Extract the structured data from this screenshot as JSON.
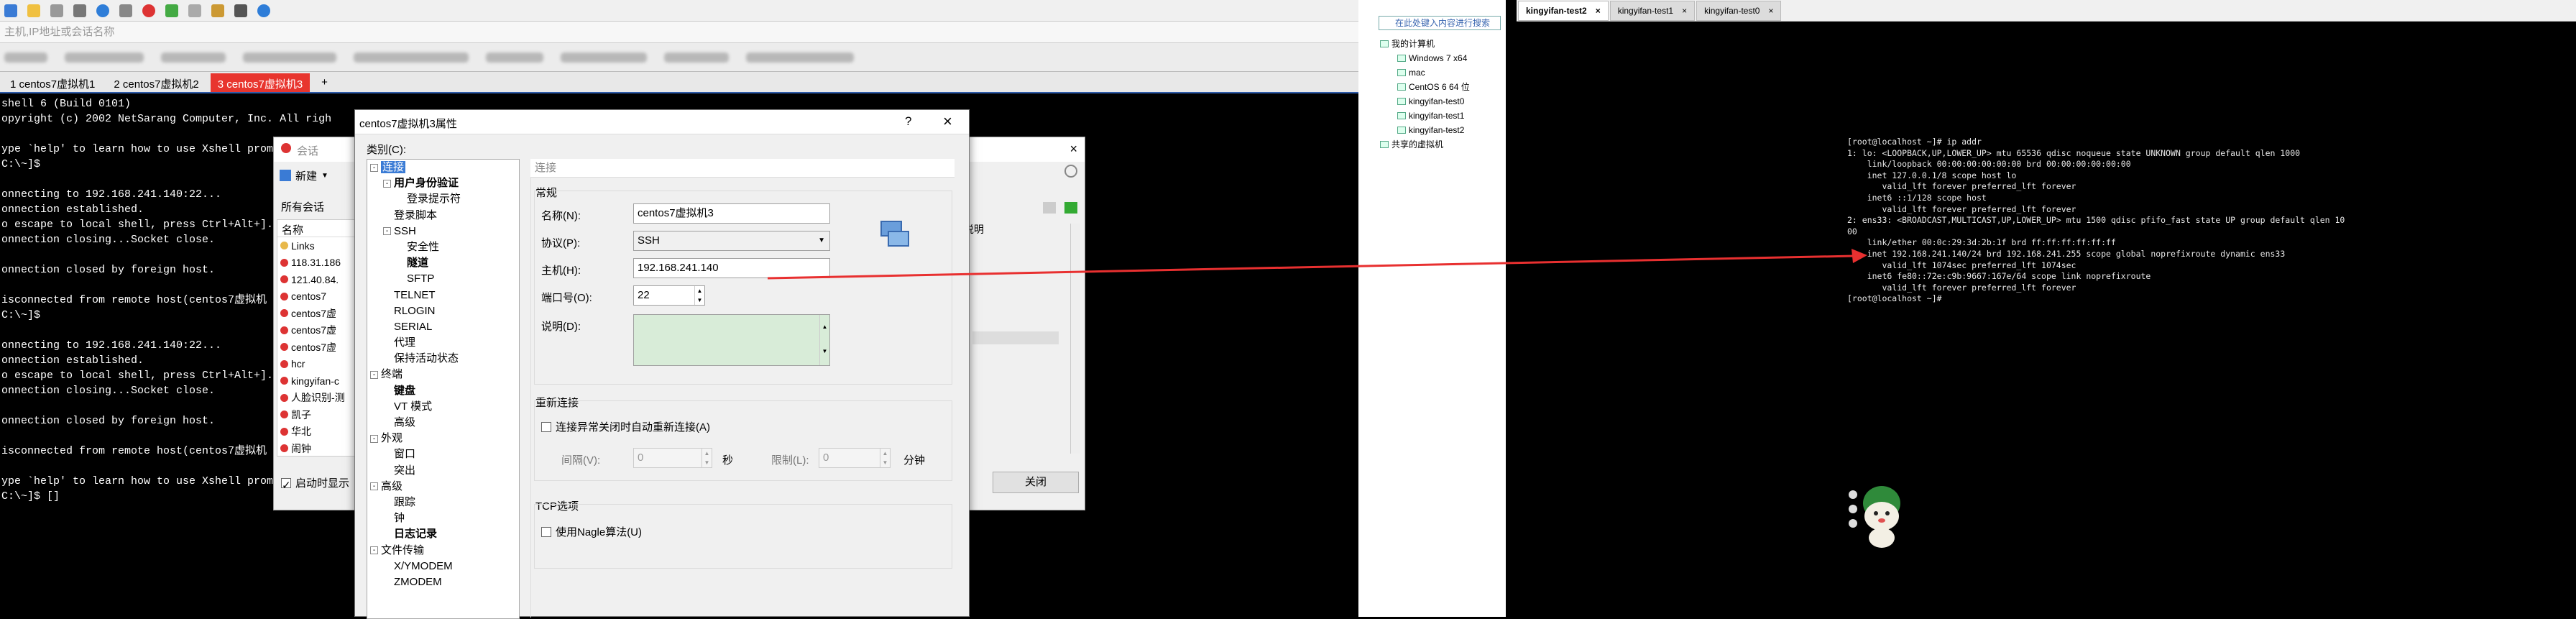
{
  "xshell": {
    "address_placeholder": "主机,IP地址或会话名称",
    "tabs": [
      {
        "label": "1 centos7虚拟机1"
      },
      {
        "label": "2 centos7虚拟机2"
      },
      {
        "label": "3 centos7虚拟机3"
      },
      {
        "label": "+"
      }
    ],
    "terminal_lines": [
      "shell 6 (Build 0101)",
      "opyright (c) 2002 NetSarang Computer, Inc. All righ",
      "",
      "ype `help' to learn how to use Xshell prom",
      "C:\\~]$",
      "",
      "onnecting to 192.168.241.140:22...",
      "onnection established.",
      "o escape to local shell, press Ctrl+Alt+].",
      "onnection closing...Socket close.",
      "",
      "onnection closed by foreign host.",
      "",
      "isconnected from remote host(centos7虚拟机",
      "C:\\~]$",
      "",
      "onnecting to 192.168.241.140:22...",
      "onnection established.",
      "o escape to local shell, press Ctrl+Alt+].",
      "onnection closing...Socket close.",
      "",
      "onnection closed by foreign host.",
      "",
      "isconnected from remote host(centos7虚拟机",
      "",
      "ype `help' to learn how to use Xshell prom",
      "C:\\~]$ []"
    ]
  },
  "session_dialog": {
    "title": "会话",
    "new_label": "新建",
    "all_sessions": "所有会话",
    "column_name": "名称",
    "column_desc": "说明",
    "items": [
      "Links",
      "118.31.186",
      "121.40.84.",
      "centos7",
      "centos7虚",
      "centos7虚",
      "centos7虚",
      "hcr",
      "kingyifan-c",
      "人脸识别-测",
      "凯子",
      "华北",
      "闹钟"
    ],
    "startup_checkbox": "启动时显示",
    "close_label": "关闭"
  },
  "properties_dialog": {
    "title": "centos7虚拟机3属性",
    "help": "?",
    "close": "×",
    "category_label": "类别(C):",
    "tree": [
      {
        "label": "连接",
        "level": 0,
        "box": "-",
        "selected": true
      },
      {
        "label": "用户身份验证",
        "level": 1,
        "box": "-",
        "bold": true
      },
      {
        "label": "登录提示符",
        "level": 2
      },
      {
        "label": "登录脚本",
        "level": 1
      },
      {
        "label": "SSH",
        "level": 1,
        "box": "-"
      },
      {
        "label": "安全性",
        "level": 2
      },
      {
        "label": "隧道",
        "level": 2,
        "bold": true
      },
      {
        "label": "SFTP",
        "level": 2
      },
      {
        "label": "TELNET",
        "level": 1
      },
      {
        "label": "RLOGIN",
        "level": 1
      },
      {
        "label": "SERIAL",
        "level": 1
      },
      {
        "label": "代理",
        "level": 1
      },
      {
        "label": "保持活动状态",
        "level": 1
      },
      {
        "label": "终端",
        "level": 0,
        "box": "-"
      },
      {
        "label": "键盘",
        "level": 1,
        "bold": true
      },
      {
        "label": "VT 模式",
        "level": 1
      },
      {
        "label": "高级",
        "level": 1
      },
      {
        "label": "外观",
        "level": 0,
        "box": "-"
      },
      {
        "label": "窗口",
        "level": 1
      },
      {
        "label": "突出",
        "level": 1
      },
      {
        "label": "高级",
        "level": 0,
        "box": "-"
      },
      {
        "label": "跟踪",
        "level": 1
      },
      {
        "label": "钟",
        "level": 1
      },
      {
        "label": "日志记录",
        "level": 1,
        "bold": true
      },
      {
        "label": "文件传输",
        "level": 0,
        "box": "-"
      },
      {
        "label": "X/YMODEM",
        "level": 1
      },
      {
        "label": "ZMODEM",
        "level": 1
      }
    ],
    "section_header": "连接",
    "general_label": "常规",
    "name_label": "名称(N):",
    "name_value": "centos7虚拟机3",
    "protocol_label": "协议(P):",
    "protocol_value": "SSH",
    "host_label": "主机(H):",
    "host_value": "192.168.241.140",
    "port_label": "端口号(O):",
    "port_value": "22",
    "desc_label": "说明(D):",
    "reconnect_label": "重新连接",
    "reconnect_checkbox": "连接异常关闭时自动重新连接(A)",
    "interval_label": "间隔(V):",
    "interval_value": "0",
    "interval_unit": "秒",
    "limit_label": "限制(L):",
    "limit_value": "0",
    "limit_unit": "分钟",
    "tcp_label": "TCP选项",
    "nagle_checkbox": "使用Nagle算法(U)"
  },
  "vmware": {
    "search_placeholder": "在此处键入内容进行搜索",
    "library": [
      {
        "label": "我的计算机",
        "level": 0
      },
      {
        "label": "Windows 7 x64",
        "level": 1
      },
      {
        "label": "mac",
        "level": 1
      },
      {
        "label": "CentOS 6 64 位",
        "level": 1
      },
      {
        "label": "kingyifan-test0",
        "level": 1
      },
      {
        "label": "kingyifan-test1",
        "level": 1
      },
      {
        "label": "kingyifan-test2",
        "level": 1
      },
      {
        "label": "共享的虚拟机",
        "level": 0
      }
    ],
    "tabs": [
      {
        "label": "kingyifan-test2",
        "active": true
      },
      {
        "label": "kingyifan-test1"
      },
      {
        "label": "kingyifan-test0"
      }
    ],
    "tab_close": "×",
    "console_lines": [
      "[root@localhost ~]# ip addr",
      "1: lo: <LOOPBACK,UP,LOWER_UP> mtu 65536 qdisc noqueue state UNKNOWN group default qlen 1000",
      "    link/loopback 00:00:00:00:00:00 brd 00:00:00:00:00:00",
      "    inet 127.0.0.1/8 scope host lo",
      "       valid_lft forever preferred_lft forever",
      "    inet6 ::1/128 scope host",
      "       valid_lft forever preferred_lft forever",
      "2: ens33: <BROADCAST,MULTICAST,UP,LOWER_UP> mtu 1500 qdisc pfifo_fast state UP group default qlen 10",
      "00",
      "    link/ether 00:0c:29:3d:2b:1f brd ff:ff:ff:ff:ff:ff",
      "    inet 192.168.241.140/24 brd 192.168.241.255 scope global noprefixroute dynamic ens33",
      "       valid_lft 1074sec preferred_lft 1074sec",
      "    inet6 fe80::72e:c9b:9667:167e/64 scope link noprefixroute",
      "       valid_lft forever preferred_lft forever",
      "[root@localhost ~]#"
    ]
  },
  "colors": {
    "accent_red": "#e8352e",
    "arrow": "#e83030",
    "xshell_tab_active": "#e8352e"
  }
}
